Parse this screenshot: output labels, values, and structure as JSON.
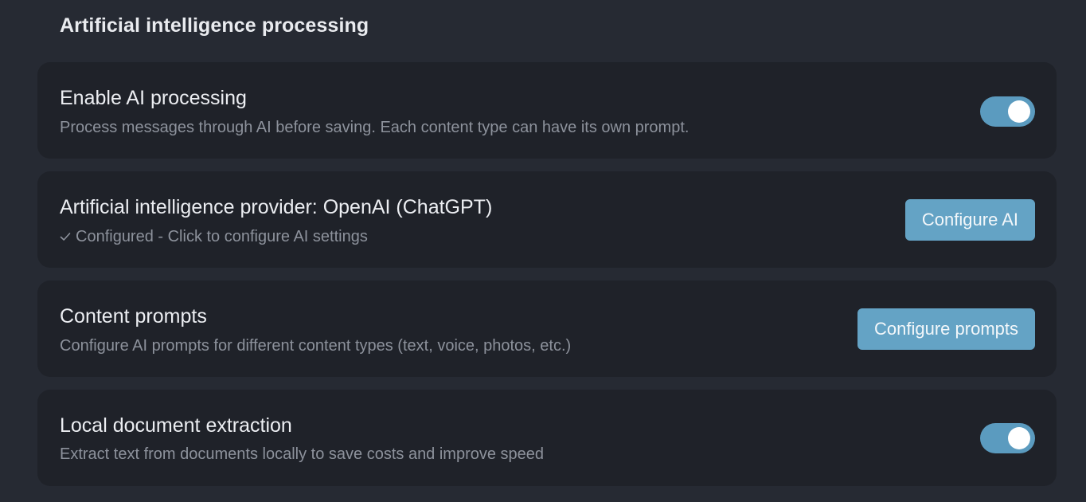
{
  "section": {
    "title": "Artificial intelligence processing"
  },
  "settings": [
    {
      "title": "Enable AI processing",
      "description": "Process messages through AI before saving. Each content type can have its own prompt.",
      "control": "toggle",
      "enabled": true
    },
    {
      "title": "Artificial intelligence provider: OpenAI (ChatGPT)",
      "description": "Configured - Click to configure AI settings",
      "status_icon": "check-icon",
      "control": "button",
      "button_label": "Configure AI"
    },
    {
      "title": "Content prompts",
      "description": "Configure AI prompts for different content types (text, voice, photos, etc.)",
      "control": "button",
      "button_label": "Configure prompts"
    },
    {
      "title": "Local document extraction",
      "description": "Extract text from documents locally to save costs and improve speed",
      "control": "toggle",
      "enabled": true
    }
  ],
  "colors": {
    "background": "#262a33",
    "card": "#1f2229",
    "accent": "#64a3c5",
    "toggle_on": "#5b9bbf",
    "muted_text": "#8d929c"
  }
}
